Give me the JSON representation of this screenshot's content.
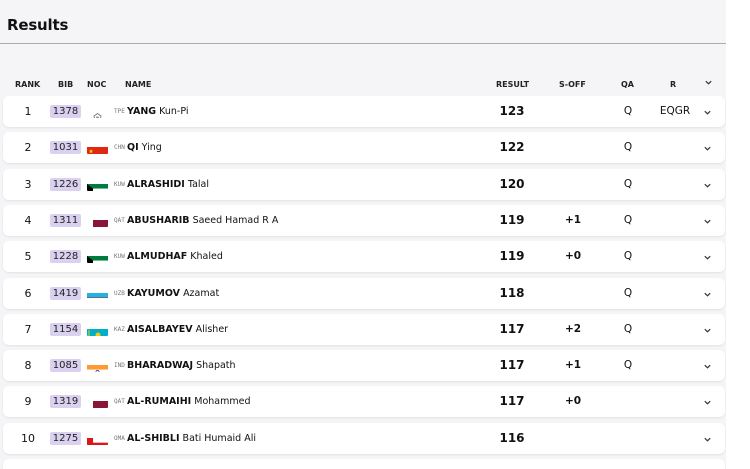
{
  "title": "Results",
  "columns": {
    "rank": "RANK",
    "bib": "BIB",
    "noc": "NOC",
    "name": "NAME",
    "result": "RESULT",
    "soff": "S-OFF",
    "qa": "QA",
    "r": "R"
  },
  "rows": [
    {
      "rank": "1",
      "bib": "1378",
      "noc": "TPE",
      "surname": "YANG",
      "given": "Kun-Pi",
      "result": "123",
      "soff": "",
      "qa": "Q",
      "r": "EQGR",
      "flag": "tpe"
    },
    {
      "rank": "2",
      "bib": "1031",
      "noc": "CHN",
      "surname": "QI",
      "given": "Ying",
      "result": "122",
      "soff": "",
      "qa": "Q",
      "r": "",
      "flag": "chn"
    },
    {
      "rank": "3",
      "bib": "1226",
      "noc": "KUW",
      "surname": "ALRASHIDI",
      "given": "Talal",
      "result": "120",
      "soff": "",
      "qa": "Q",
      "r": "",
      "flag": "kuw"
    },
    {
      "rank": "4",
      "bib": "1311",
      "noc": "QAT",
      "surname": "ABUSHARIB",
      "given": "Saeed Hamad R A",
      "result": "119",
      "soff": "+1",
      "qa": "Q",
      "r": "",
      "flag": "qat"
    },
    {
      "rank": "5",
      "bib": "1228",
      "noc": "KUW",
      "surname": "ALMUDHAF",
      "given": "Khaled",
      "result": "119",
      "soff": "+0",
      "qa": "Q",
      "r": "",
      "flag": "kuw"
    },
    {
      "rank": "6",
      "bib": "1419",
      "noc": "UZB",
      "surname": "KAYUMOV",
      "given": "Azamat",
      "result": "118",
      "soff": "",
      "qa": "Q",
      "r": "",
      "flag": "uzb"
    },
    {
      "rank": "7",
      "bib": "1154",
      "noc": "KAZ",
      "surname": "AISALBAYEV",
      "given": "Alisher",
      "result": "117",
      "soff": "+2",
      "qa": "Q",
      "r": "",
      "flag": "kaz"
    },
    {
      "rank": "8",
      "bib": "1085",
      "noc": "IND",
      "surname": "BHARADWAJ",
      "given": "Shapath",
      "result": "117",
      "soff": "+1",
      "qa": "Q",
      "r": "",
      "flag": "ind"
    },
    {
      "rank": "9",
      "bib": "1319",
      "noc": "QAT",
      "surname": "AL-RUMAIHI",
      "given": "Mohammed",
      "result": "117",
      "soff": "+0",
      "qa": "",
      "r": "",
      "flag": "qat"
    },
    {
      "rank": "10",
      "bib": "1275",
      "noc": "OMA",
      "surname": "AL-SHIBLI",
      "given": "Bati Humaid Ali",
      "result": "116",
      "soff": "",
      "qa": "",
      "r": "",
      "flag": "oma"
    }
  ],
  "colors": {
    "bib_bg": "#d9d1ef",
    "row_bg": "#ffffff",
    "page_bg": "#f5f5f7"
  },
  "icons": {
    "expand": "chevron-down-icon"
  }
}
